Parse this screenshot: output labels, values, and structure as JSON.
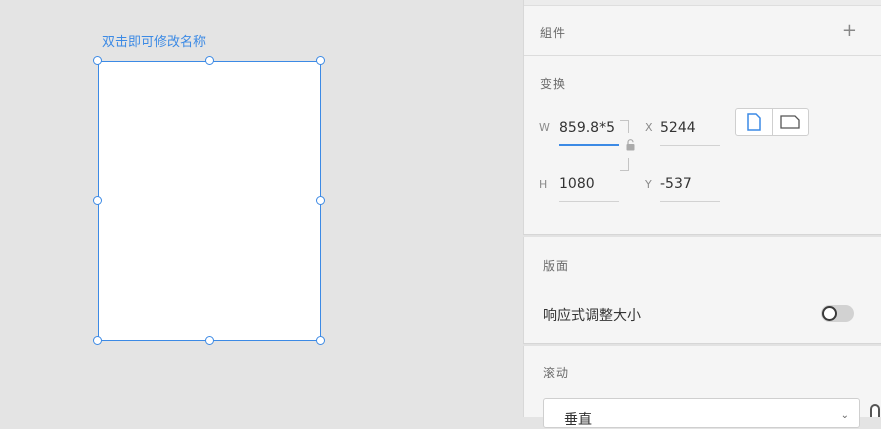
{
  "canvas": {
    "artboard_name": "双击即可修改名称"
  },
  "panel": {
    "components": {
      "title": "組件",
      "add_icon": "+"
    },
    "transform": {
      "title": "变换",
      "width_label": "W",
      "width_value": "859.8*5",
      "height_label": "H",
      "height_value": "1080",
      "x_label": "X",
      "x_value": "5244",
      "y_label": "Y",
      "y_value": "-537",
      "lock_icon": "lock-icon",
      "orientation": [
        "portrait-icon",
        "landscape-icon"
      ]
    },
    "layout": {
      "title": "版面",
      "responsive_label": "响应式调整大小",
      "responsive_enabled": false
    },
    "scroll": {
      "title": "滚动",
      "select_value": "垂直"
    }
  },
  "colors": {
    "accent": "#3c8ae5",
    "canvas_bg": "#e4e4e4",
    "panel_bg": "#f5f5f5"
  }
}
